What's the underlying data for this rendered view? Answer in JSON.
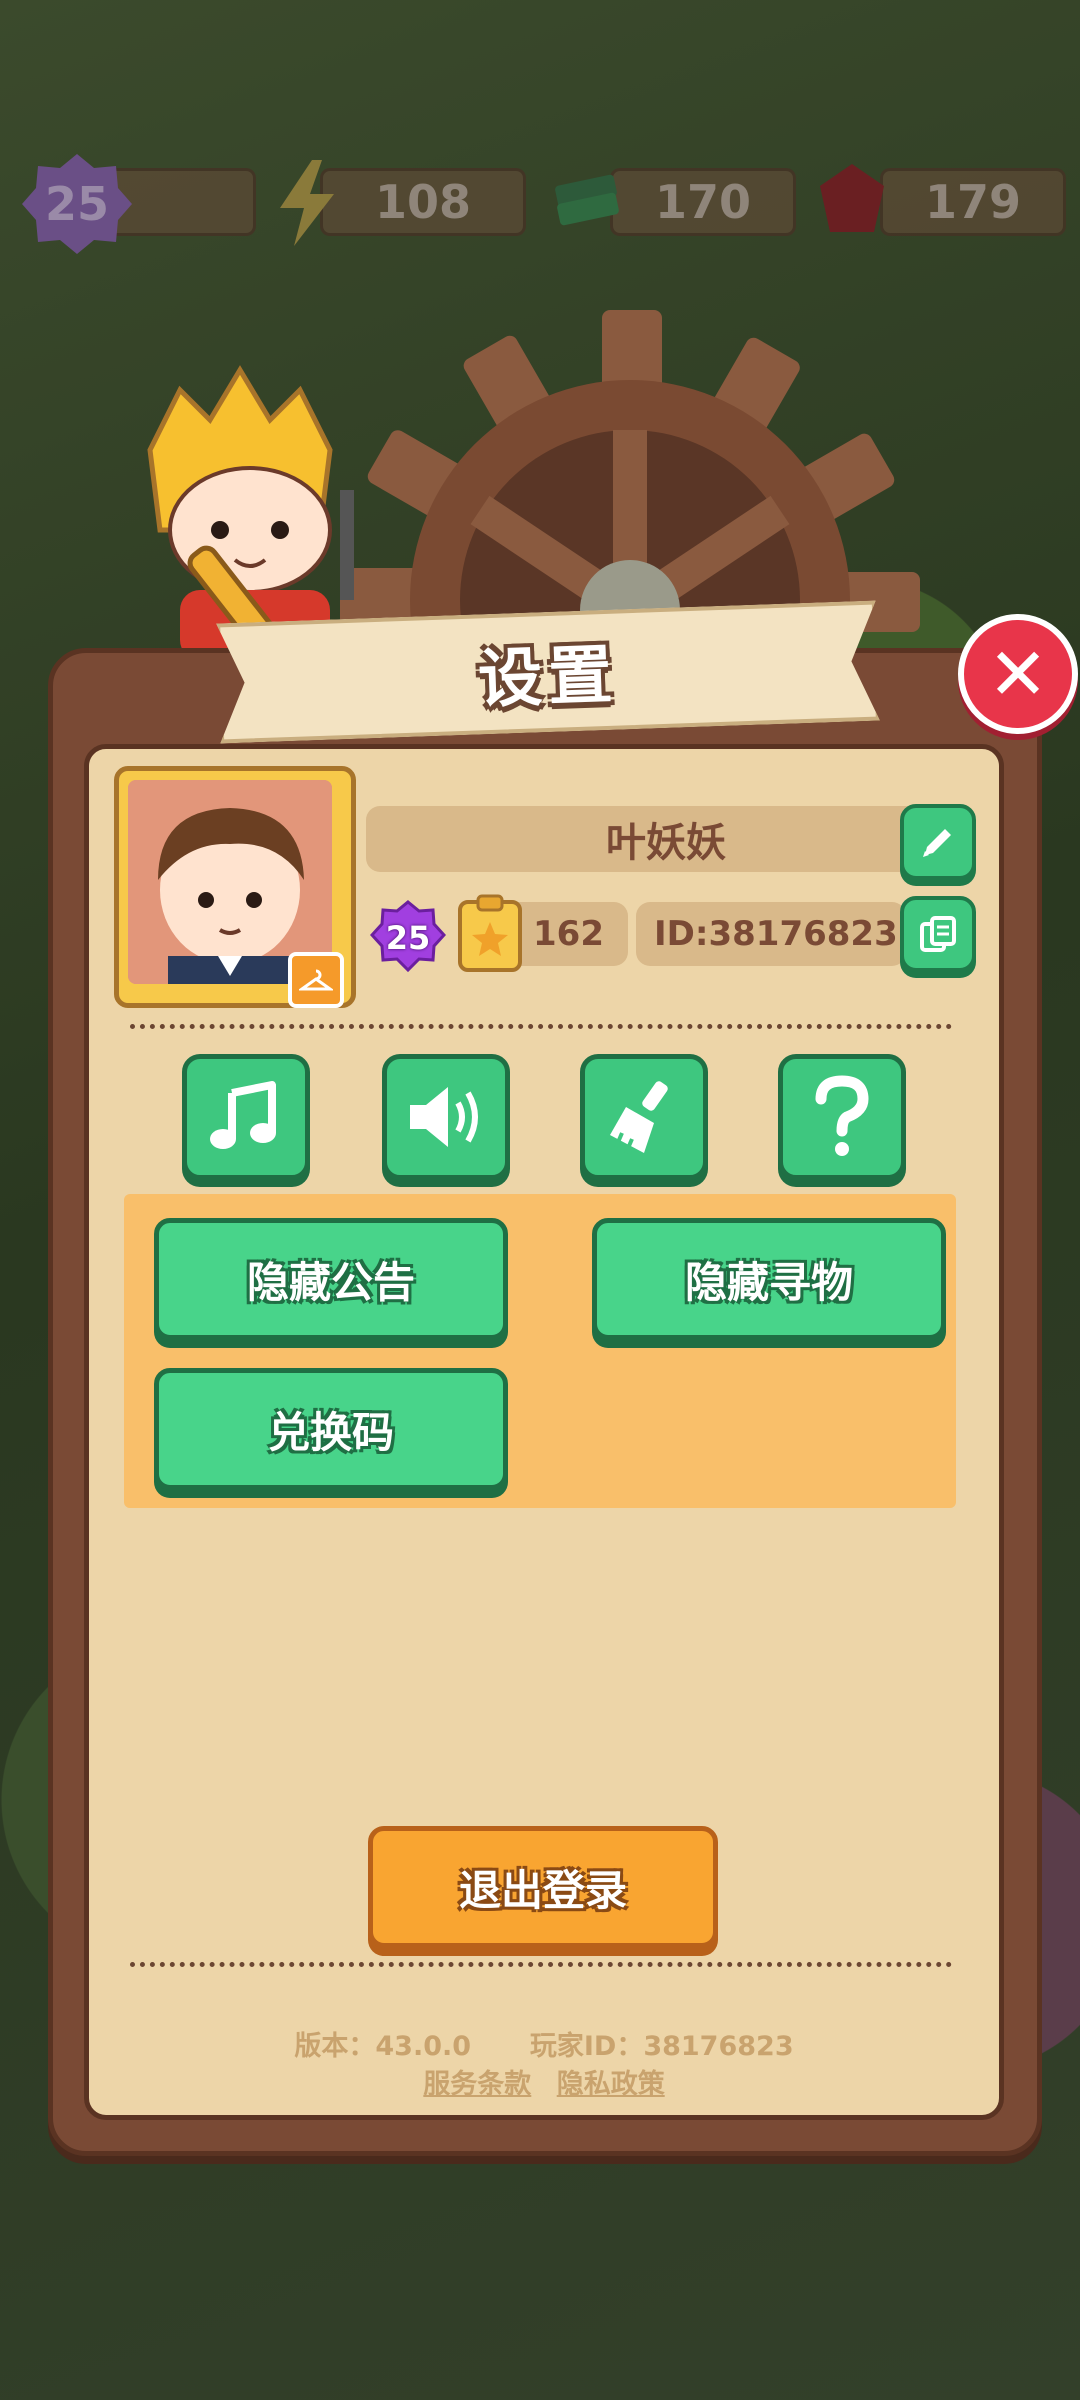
{
  "hud": {
    "level": "25",
    "energy": "108",
    "cash": "170",
    "gems": "179"
  },
  "dialog": {
    "title": "设置",
    "profile": {
      "name": "叶妖妖",
      "level": "25",
      "task_count": "162",
      "player_id_label": "ID:38176823"
    },
    "icon_buttons": [
      {
        "name": "music",
        "icon": "music-note-icon"
      },
      {
        "name": "sound",
        "icon": "speaker-icon"
      },
      {
        "name": "clear-cache",
        "icon": "broom-icon"
      },
      {
        "name": "help",
        "icon": "question-icon"
      }
    ],
    "options": {
      "hide_announcement": "隐藏公告",
      "hide_search": "隐藏寻物",
      "redeem_code": "兑换码"
    },
    "logout_label": "退出登录",
    "footer": {
      "version": "版本：43.0.0",
      "player_id": "玩家ID：38176823",
      "terms": "服务条款",
      "privacy": "隐私政策"
    }
  },
  "colors": {
    "panel_border": "#7a4a35",
    "panel_bg": "#edd5a8",
    "green_button": "#48d48a",
    "orange_button": "#f9a531",
    "close_red": "#e8354a",
    "option_area": "#f9bf6a"
  }
}
